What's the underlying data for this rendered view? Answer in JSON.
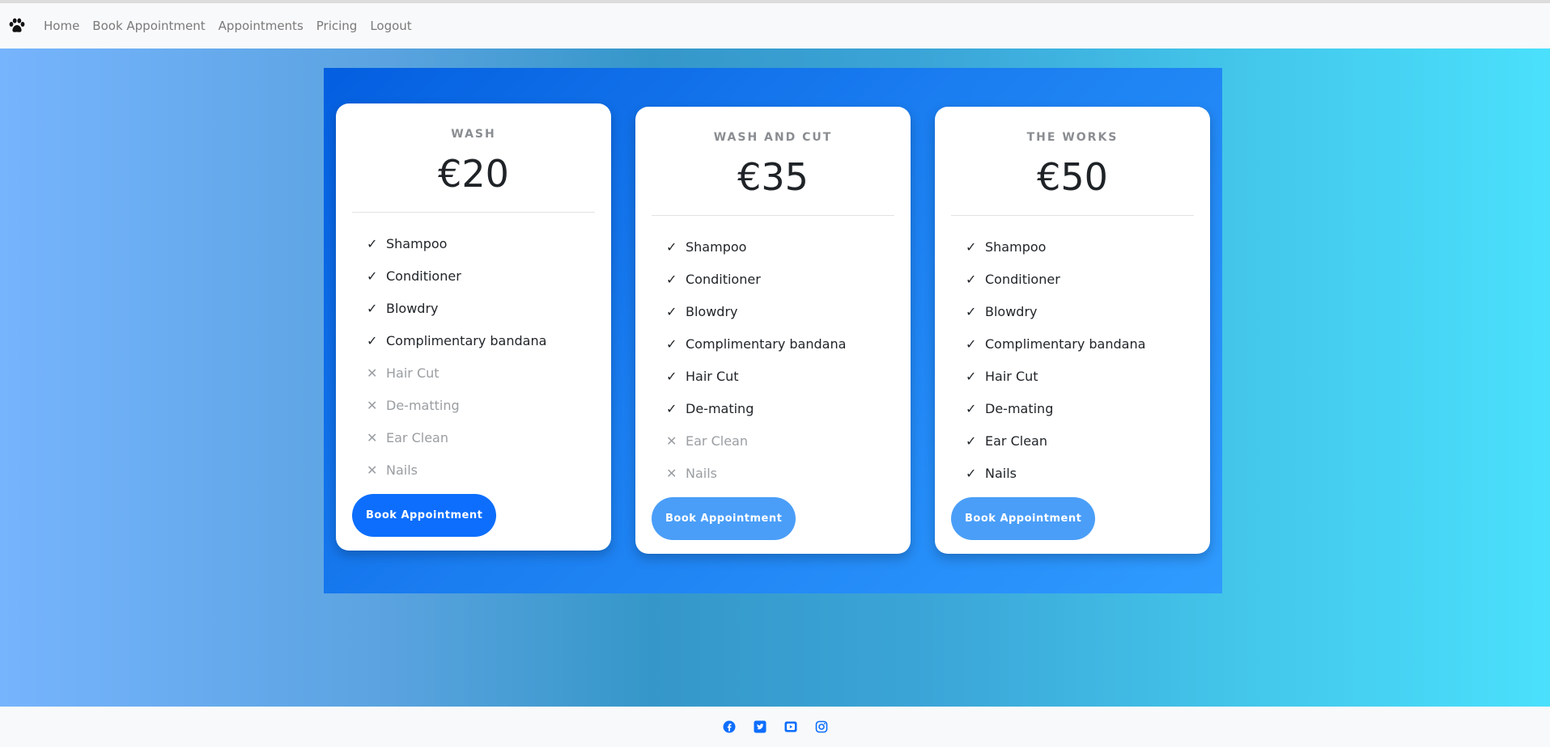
{
  "nav": {
    "brand_icon": "paw-icon",
    "links": [
      "Home",
      "Book Appointment",
      "Appointments",
      "Pricing",
      "Logout"
    ]
  },
  "plans": [
    {
      "title": "WASH",
      "price": "€20",
      "features": [
        {
          "label": "Shampoo",
          "included": true
        },
        {
          "label": "Conditioner",
          "included": true
        },
        {
          "label": "Blowdry",
          "included": true
        },
        {
          "label": "Complimentary bandana",
          "included": true
        },
        {
          "label": "Hair Cut",
          "included": false
        },
        {
          "label": "De-matting",
          "included": false
        },
        {
          "label": "Ear Clean",
          "included": false
        },
        {
          "label": "Nails",
          "included": false
        }
      ],
      "button": "Book Appointment",
      "button_color": "#0d6efd"
    },
    {
      "title": "WASH AND CUT",
      "price": "€35",
      "features": [
        {
          "label": "Shampoo",
          "included": true
        },
        {
          "label": "Conditioner",
          "included": true
        },
        {
          "label": "Blowdry",
          "included": true
        },
        {
          "label": "Complimentary bandana",
          "included": true
        },
        {
          "label": "Hair Cut",
          "included": true
        },
        {
          "label": "De-mating",
          "included": true
        },
        {
          "label": "Ear Clean",
          "included": false
        },
        {
          "label": "Nails",
          "included": false
        }
      ],
      "button": "Book Appointment",
      "button_color": "#4a9ef8"
    },
    {
      "title": "THE WORKS",
      "price": "€50",
      "features": [
        {
          "label": "Shampoo",
          "included": true
        },
        {
          "label": "Conditioner",
          "included": true
        },
        {
          "label": "Blowdry",
          "included": true
        },
        {
          "label": "Complimentary bandana",
          "included": true
        },
        {
          "label": "Hair Cut",
          "included": true
        },
        {
          "label": "De-mating",
          "included": true
        },
        {
          "label": "Ear Clean",
          "included": true
        },
        {
          "label": "Nails",
          "included": true
        }
      ],
      "button": "Book Appointment",
      "button_color": "#4a9ef8"
    }
  ],
  "footer": {
    "icons": [
      "facebook-icon",
      "twitter-icon",
      "youtube-icon",
      "instagram-icon"
    ],
    "icon_color": "#0d6efd"
  }
}
